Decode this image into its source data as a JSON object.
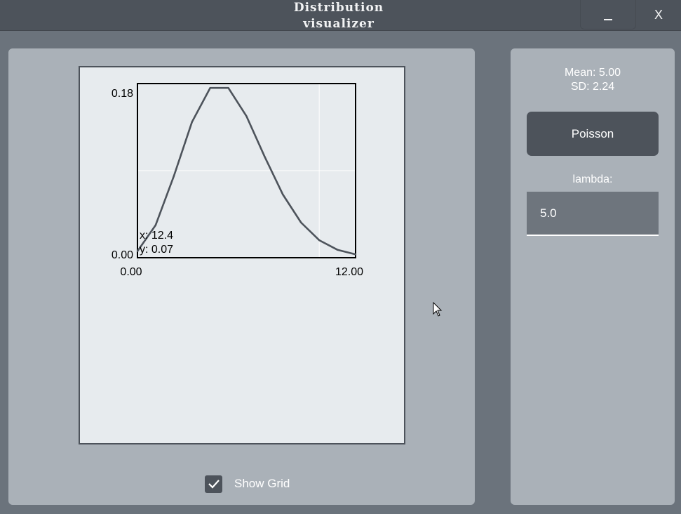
{
  "window": {
    "title": "Distribution visualizer",
    "minimize_icon": "minimize-icon",
    "close_label": "X"
  },
  "plot": {
    "grid": true,
    "y_max_label": "0.18",
    "y_min_label": "0.00",
    "x_min_label": "0.00",
    "x_max_label": "12.00",
    "hover_x": "x: 12.4",
    "hover_y": "y: 0.07",
    "line_color": "#4d535b"
  },
  "chart_data": {
    "type": "line",
    "title": "",
    "xlabel": "",
    "ylabel": "",
    "xlim": [
      0,
      12
    ],
    "ylim": [
      0,
      0.18
    ],
    "grid": true,
    "x": [
      0,
      1,
      2,
      3,
      4,
      5,
      6,
      7,
      8,
      9,
      10,
      11,
      12
    ],
    "series": [
      {
        "values": [
          0.0067,
          0.0337,
          0.0842,
          0.1404,
          0.1755,
          0.1755,
          0.1462,
          0.1044,
          0.0653,
          0.0363,
          0.0181,
          0.0082,
          0.0034
        ]
      }
    ]
  },
  "show_grid": {
    "label": "Show Grid",
    "checked": true
  },
  "stats": {
    "mean": "Mean: 5.00",
    "sd": "SD: 2.24"
  },
  "distribution": {
    "label": "Poisson"
  },
  "parameter": {
    "label": "lambda:",
    "value": "5.0"
  }
}
